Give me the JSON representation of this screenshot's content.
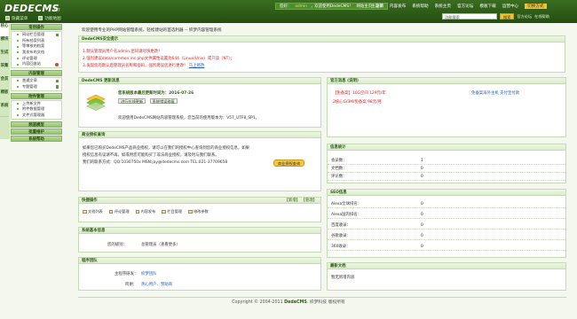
{
  "header": {
    "logo": "DEDECMS",
    "version": "v5.7",
    "toolbar": [
      {
        "label": "隐藏菜单",
        "icon": "hide-menu-icon"
      },
      {
        "label": "功能地图",
        "icon": "map-icon"
      }
    ],
    "userbar": {
      "prefix": "您好：",
      "user": "admin",
      "sep": "，欢迎使用DedeCMS！",
      "home": "网站主页",
      "logout": "注销"
    },
    "nav": [
      "主菜单",
      "内容发布",
      "系统帮助",
      "系统主页",
      "官方论坛",
      "模板下载",
      "运营中心"
    ],
    "nav_active": "系统主页",
    "nav_extra": "切换方式",
    "search": {
      "placeholder": "功能搜索",
      "button": "搜索",
      "links": [
        "官方论坛",
        "在线帮助"
      ]
    }
  },
  "rail": [
    "核心",
    "模块",
    "生成",
    "采集",
    "会员",
    "模板",
    "系统"
  ],
  "menu": [
    {
      "title": "常用操作",
      "items": [
        {
          "label": "网站栏目管理",
          "add": true
        },
        {
          "label": "所有档案列表"
        },
        {
          "label": "等审核的档案"
        },
        {
          "label": "我发布的文档"
        },
        {
          "label": "评论管理"
        },
        {
          "label": "内容回收站",
          "tag": true
        }
      ]
    },
    {
      "title": "内容管理",
      "items": [
        {
          "label": "普通文章",
          "add": true
        },
        {
          "label": "专题管理",
          "add": true
        }
      ]
    },
    {
      "title": "附件管理",
      "items": [
        {
          "label": "上传新文件"
        },
        {
          "label": "附件数据管理"
        },
        {
          "label": "文件式管理器"
        }
      ]
    },
    {
      "title": "频道模型",
      "items": []
    },
    {
      "title": "批量维护",
      "items": []
    },
    {
      "title": "系统帮助",
      "items": []
    }
  ],
  "welcome": "欢迎使用专业的PHP网站管理系统，轻松建站的首选利器 -- 织梦内容管理系统",
  "security": {
    "title": "DedeCMS安全提示",
    "lines": [
      "1.默认管理员用户名admin,密码请尽快更改！",
      "2.强烈建议data/common.inc.php文件属性设置为644（Linux/Unix）或只读（NT）；",
      "3.发现您的默认后管理员名称和密码，强烈建议您进行更改！  马上修改"
    ],
    "fix_link": "马上修改"
  },
  "update": {
    "title": "DedeCMS 更新消息",
    "date_line": "您系统版本最后更新时间为：2016-07-26",
    "buttons": [
      "进行在线更新",
      "系统错误修复"
    ],
    "info": "欢迎使用DedeCMS网站内容管理系统，您当前的使用版本为：V57_UTF8_SP1。"
  },
  "business": {
    "title": "商业授权查询",
    "lines": [
      "如果您已购买DedeCMS产品商业授权，请可以在我们的授权中心查询到您的商业授权信息，如果",
      "授权信息有误请不再，如或用您可能购买了非法商业授权，请及时与我们联系。",
      "我们的联系方式：QQ:1030750x  MSN:jay@dedecms.com  TEL:021-37709658"
    ],
    "button": "商业授权查询"
  },
  "quick": {
    "title": "快捷操作",
    "actions": [
      "【新增】",
      "【管理】"
    ],
    "links": [
      {
        "label": "文档列表",
        "icon": "doc-list-icon"
      },
      {
        "label": "评论管理",
        "icon": "comment-icon"
      },
      {
        "label": "内容发布",
        "icon": "publish-icon"
      },
      {
        "label": "栏目管理",
        "icon": "column-icon"
      },
      {
        "label": "修改参数",
        "icon": "settings-icon"
      }
    ]
  },
  "sysinfo": {
    "title": "系统基本信息",
    "label": "您的级别：",
    "value": "总管理员（查看更多）"
  },
  "team": {
    "title": "程序团队",
    "rows": [
      {
        "key": "主程序研发：",
        "value": "织梦团队"
      },
      {
        "key": "鸣谢：",
        "value": "热心用户、赞助商"
      }
    ]
  },
  "official": {
    "title": "官方消息 (说明)",
    "items": [
      {
        "text": "【免备案】10G空间 129元/年",
        "color": "#d21f1f"
      },
      {
        "text": "免备案海外主机 支付宝付款",
        "color": "#2659b8"
      },
      {
        "text": "2核心G/3M/免备案 98元/月",
        "color": "#d21f1f"
      }
    ]
  },
  "stats": {
    "title": "信息统计",
    "rows": [
      {
        "key": "会员数：",
        "value": "1"
      },
      {
        "key": "文档数：",
        "value": "0"
      },
      {
        "key": "评论数：",
        "value": "0"
      }
    ]
  },
  "seo": {
    "title": "SEO信息",
    "rows": [
      {
        "key": "Alexa全球排名：",
        "value": "0"
      },
      {
        "key": "Alexa国内排名：",
        "value": "0"
      },
      {
        "key": "百度收录：",
        "value": "0"
      },
      {
        "key": "谷歌收录：",
        "value": "0"
      },
      {
        "key": "360收录：",
        "value": "0"
      }
    ]
  },
  "recent": {
    "title": "最新文档",
    "empty": "暂无新增内容"
  },
  "footer": {
    "pre": "Copyright © 2004-2011 ",
    "brand": "DedeCMS",
    "post": ". 织梦科技 版权所有"
  }
}
